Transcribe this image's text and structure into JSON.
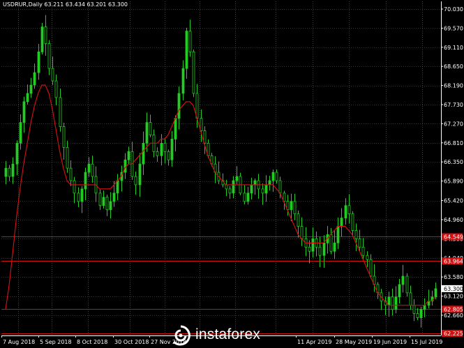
{
  "chart_title": "USDRUR,Daily  63.211 63.434 63.201 63.300",
  "brand": "instaforex",
  "colors": {
    "background": "#000000",
    "grid": "#6a6a6a",
    "candle": "#22cc22",
    "moving_average": "#d01010",
    "hline": "#d01010",
    "axis_text": "#ffffff"
  },
  "chart_data": {
    "type": "candlestick",
    "title": "USDRUR,Daily",
    "quote": "63.211 63.434 63.201 63.300",
    "ylim": [
      62.2,
      70.03
    ],
    "y_ticks": [
      "70.030",
      "69.570",
      "69.110",
      "68.650",
      "68.190",
      "67.730",
      "67.270",
      "66.810",
      "66.350",
      "65.890",
      "65.420",
      "64.960",
      "64.500",
      "64.040",
      "63.580",
      "63.120",
      "62.660"
    ],
    "x_tick_labels": [
      "7 Aug 2018",
      "5 Sep 2018",
      "8 Oct 2018",
      "30 Oct 2018",
      "27 Nov 2018",
      "11 Apr 2019",
      "28 May 2019",
      "19 Jun 2019",
      "15 Jul 2019"
    ],
    "current_price": "63.300",
    "price_levels": [
      {
        "label": "64.549",
        "value": 64.549
      },
      {
        "label": "63.964",
        "value": 63.964
      },
      {
        "label": "62.805",
        "value": 62.805
      },
      {
        "label": "62.225",
        "value": 62.225
      }
    ],
    "close_series": [
      66.2,
      66.0,
      66.3,
      66.8,
      67.3,
      67.8,
      68.0,
      68.2,
      68.5,
      69.0,
      69.6,
      69.2,
      68.6,
      68.3,
      67.9,
      67.2,
      66.7,
      66.2,
      65.9,
      65.6,
      65.4,
      65.7,
      66.1,
      66.3,
      66.0,
      65.6,
      65.3,
      65.5,
      65.2,
      65.4,
      65.6,
      65.9,
      66.1,
      66.4,
      66.6,
      66.0,
      65.8,
      66.3,
      66.8,
      67.3,
      67.0,
      66.6,
      66.5,
      66.8,
      66.6,
      66.4,
      66.9,
      67.4,
      68.0,
      68.6,
      69.5,
      69.0,
      68.0,
      67.4,
      67.1,
      66.8,
      66.5,
      66.3,
      66.1,
      65.9,
      65.8,
      65.7,
      65.6,
      65.9,
      66.0,
      65.6,
      65.4,
      65.6,
      65.8,
      65.9,
      65.7,
      65.6,
      65.8,
      65.9,
      66.1,
      65.9,
      65.6,
      65.4,
      65.2,
      65.4,
      65.1,
      64.8,
      64.5,
      64.3,
      64.2,
      64.5,
      64.3,
      64.1,
      64.4,
      64.6,
      64.2,
      64.4,
      64.8,
      65.0,
      65.3,
      65.1,
      64.7,
      64.5,
      64.3,
      64.1,
      64.0,
      63.6,
      63.4,
      63.2,
      63.0,
      62.9,
      63.1,
      62.8,
      63.1,
      63.4,
      63.6,
      63.2,
      62.9,
      62.7,
      62.6,
      62.8,
      62.9,
      63.0,
      63.1,
      63.3
    ],
    "ma_series": [
      62.8,
      63.4,
      64.2,
      65.0,
      65.7,
      66.3,
      66.8,
      67.3,
      67.7,
      68.0,
      68.2,
      68.2,
      68.0,
      67.6,
      67.1,
      66.6,
      66.2,
      65.9,
      65.8,
      65.8,
      65.8,
      65.8,
      65.8,
      65.8,
      65.8,
      65.8,
      65.7,
      65.7,
      65.7,
      65.7,
      65.8,
      65.9,
      66.0,
      66.2,
      66.3,
      66.3,
      66.4,
      66.5,
      66.6,
      66.7,
      66.8,
      66.8,
      66.8,
      66.9,
      66.9,
      67.0,
      67.2,
      67.4,
      67.6,
      67.7,
      67.8,
      67.8,
      67.7,
      67.4,
      67.1,
      66.8,
      66.5,
      66.3,
      66.1,
      66.0,
      65.9,
      65.8,
      65.8,
      65.8,
      65.8,
      65.8,
      65.8,
      65.8,
      65.8,
      65.8,
      65.8,
      65.8,
      65.8,
      65.8,
      65.8,
      65.7,
      65.6,
      65.4,
      65.2,
      65.0,
      64.8,
      64.6,
      64.5,
      64.4,
      64.4,
      64.4,
      64.4,
      64.4,
      64.4,
      64.5,
      64.6,
      64.7,
      64.8,
      64.8,
      64.8,
      64.7,
      64.6,
      64.4,
      64.2,
      64.0,
      63.8,
      63.6,
      63.4,
      63.2,
      63.1,
      63.0,
      62.9,
      62.9,
      62.9,
      62.9,
      62.9,
      62.9,
      62.9,
      62.9,
      62.9,
      62.9,
      62.9,
      63.0,
      63.0,
      63.1
    ]
  }
}
